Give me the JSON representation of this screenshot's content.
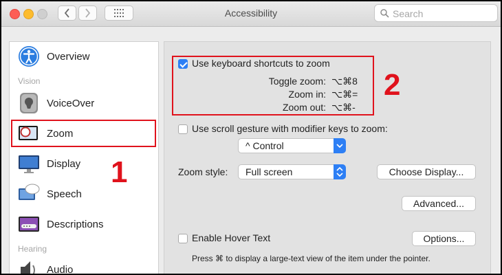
{
  "window": {
    "title": "Accessibility"
  },
  "search": {
    "placeholder": "Search"
  },
  "sidebar": {
    "categories": {
      "vision": "Vision",
      "hearing": "Hearing"
    },
    "items": [
      {
        "label": "Overview",
        "icon": "accessibility-icon"
      },
      {
        "label": "VoiceOver",
        "icon": "voiceover-icon"
      },
      {
        "label": "Zoom",
        "icon": "zoom-icon",
        "selected": true
      },
      {
        "label": "Display",
        "icon": "display-icon"
      },
      {
        "label": "Speech",
        "icon": "speech-icon"
      },
      {
        "label": "Descriptions",
        "icon": "descriptions-icon"
      },
      {
        "label": "Audio",
        "icon": "audio-icon"
      }
    ]
  },
  "zoom": {
    "keyboard_shortcuts": {
      "label": "Use keyboard shortcuts to zoom",
      "checked": true,
      "toggle_label": "Toggle zoom:",
      "toggle_keys": "⌥⌘8",
      "in_label": "Zoom in:",
      "in_keys": "⌥⌘=",
      "out_label": "Zoom out:",
      "out_keys": "⌥⌘-"
    },
    "scroll_gesture": {
      "label": "Use scroll gesture with modifier keys to zoom:",
      "checked": false,
      "modifier_value": "^ Control"
    },
    "zoom_style": {
      "label": "Zoom style:",
      "value": "Full screen"
    },
    "choose_display_label": "Choose Display...",
    "advanced_label": "Advanced...",
    "hover_text": {
      "label": "Enable Hover Text",
      "checked": false
    },
    "options_label": "Options...",
    "hover_hint": "Press ⌘ to display a large-text view of the item under the pointer."
  },
  "annotations": {
    "one": "1",
    "two": "2"
  },
  "colors": {
    "accent": "#2d7ff5",
    "annotation": "#e0121c"
  }
}
